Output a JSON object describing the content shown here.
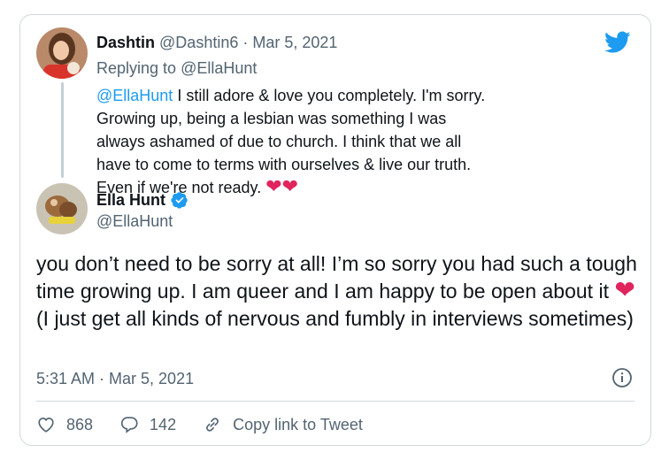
{
  "parent_tweet": {
    "display_name": "Dashtin",
    "handle": "@Dashtin6",
    "separator": " · ",
    "date": "Mar 5, 2021",
    "replying_prefix": "Replying to ",
    "replying_to": "@EllaHunt",
    "text_mention": "@EllaHunt",
    "text": " I still adore & love you completely. I'm sorry. Growing up, being a lesbian was something I was always ashamed of due to church. I think that we all have to come to terms with ourselves & live our truth. Even if we're not ready. ",
    "emoji": "❤❤"
  },
  "main_tweet": {
    "display_name": "Ella Hunt",
    "handle": "@EllaHunt",
    "text_part1": "you don’t need to be sorry at all! I’m so sorry you had such a tough time growing up. I am queer and I am happy to be open about it ",
    "emoji": "❤",
    "text_part2": " (I just get all kinds of nervous and fumbly in interviews sometimes)",
    "timestamp": "5:31 AM · Mar 5, 2021"
  },
  "actions": {
    "like_count": "868",
    "reply_count": "142",
    "copy_link_label": "Copy link to Tweet"
  },
  "colors": {
    "link_blue": "#1d9bf0",
    "heart_red": "#e0245e",
    "secondary_text": "#536471"
  },
  "icons": [
    "twitter-bird-icon",
    "verified-badge-icon",
    "info-icon",
    "heart-icon",
    "comment-icon",
    "link-icon"
  ]
}
